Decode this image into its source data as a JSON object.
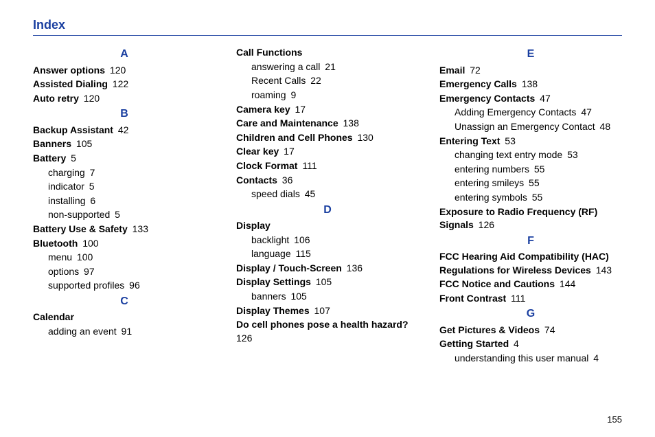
{
  "title": "Index",
  "pageNumber": "155",
  "cols": [
    {
      "blocks": [
        {
          "type": "letter",
          "text": "A"
        },
        {
          "type": "entry",
          "term": "Answer options",
          "page": "120"
        },
        {
          "type": "entry",
          "term": "Assisted Dialing",
          "page": "122"
        },
        {
          "type": "entry",
          "term": "Auto retry",
          "page": "120"
        },
        {
          "type": "letter",
          "text": "B"
        },
        {
          "type": "entry",
          "term": "Backup Assistant",
          "page": "42"
        },
        {
          "type": "entry",
          "term": "Banners",
          "page": "105"
        },
        {
          "type": "entry",
          "term": "Battery",
          "page": "5"
        },
        {
          "type": "sub",
          "term": "charging",
          "page": "7"
        },
        {
          "type": "sub",
          "term": "indicator",
          "page": "5"
        },
        {
          "type": "sub",
          "term": "installing",
          "page": "6"
        },
        {
          "type": "sub",
          "term": "non-supported",
          "page": "5"
        },
        {
          "type": "entry",
          "term": "Battery Use & Safety",
          "page": "133"
        },
        {
          "type": "entry",
          "term": "Bluetooth",
          "page": "100"
        },
        {
          "type": "sub",
          "term": "menu",
          "page": "100"
        },
        {
          "type": "sub",
          "term": "options",
          "page": "97"
        },
        {
          "type": "sub",
          "term": "supported profiles",
          "page": "96"
        },
        {
          "type": "letter",
          "text": "C"
        },
        {
          "type": "entry",
          "term": "Calendar",
          "page": ""
        },
        {
          "type": "sub",
          "term": "adding an event",
          "page": "91"
        }
      ]
    },
    {
      "blocks": [
        {
          "type": "entry",
          "term": "Call Functions",
          "page": ""
        },
        {
          "type": "sub",
          "term": "answering a call",
          "page": "21"
        },
        {
          "type": "sub",
          "term": "Recent Calls",
          "page": "22"
        },
        {
          "type": "sub",
          "term": "roaming",
          "page": "9"
        },
        {
          "type": "entry",
          "term": "Camera key",
          "page": "17"
        },
        {
          "type": "entry",
          "term": "Care and Maintenance",
          "page": "138"
        },
        {
          "type": "entry",
          "term": "Children and Cell Phones",
          "page": "130"
        },
        {
          "type": "entry",
          "term": "Clear key",
          "page": "17"
        },
        {
          "type": "entry",
          "term": "Clock Format",
          "page": "111"
        },
        {
          "type": "entry",
          "term": "Contacts",
          "page": "36"
        },
        {
          "type": "sub",
          "term": "speed dials",
          "page": "45"
        },
        {
          "type": "letter",
          "text": "D"
        },
        {
          "type": "entry",
          "term": "Display",
          "page": ""
        },
        {
          "type": "sub",
          "term": "backlight",
          "page": "106"
        },
        {
          "type": "sub",
          "term": "language",
          "page": "115"
        },
        {
          "type": "entry",
          "term": "Display / Touch-Screen",
          "page": "136"
        },
        {
          "type": "entry",
          "term": "Display Settings",
          "page": "105"
        },
        {
          "type": "sub",
          "term": "banners",
          "page": "105"
        },
        {
          "type": "entry",
          "term": "Display Themes",
          "page": "107"
        },
        {
          "type": "entry-wrap",
          "term": "Do cell phones pose a health hazard?",
          "page": "126"
        }
      ]
    },
    {
      "blocks": [
        {
          "type": "letter",
          "text": "E"
        },
        {
          "type": "entry",
          "term": "Email",
          "page": "72"
        },
        {
          "type": "entry",
          "term": "Emergency Calls",
          "page": "138"
        },
        {
          "type": "entry",
          "term": "Emergency Contacts",
          "page": "47"
        },
        {
          "type": "sub",
          "term": "Adding Emergency Contacts",
          "page": "47"
        },
        {
          "type": "sub",
          "term": "Unassign an Emergency Contact",
          "page": "48"
        },
        {
          "type": "entry",
          "term": "Entering Text",
          "page": "53"
        },
        {
          "type": "sub",
          "term": "changing text entry mode",
          "page": "53"
        },
        {
          "type": "sub",
          "term": "entering numbers",
          "page": "55"
        },
        {
          "type": "sub",
          "term": "entering smileys",
          "page": "55"
        },
        {
          "type": "sub",
          "term": "entering symbols",
          "page": "55"
        },
        {
          "type": "entry-wrap",
          "term": "Exposure to Radio Frequency (RF) Signals",
          "page": "126"
        },
        {
          "type": "letter",
          "text": "F"
        },
        {
          "type": "entry-wrap",
          "term": "FCC Hearing Aid Compatibility (HAC) Regulations for Wireless Devices",
          "page": "143"
        },
        {
          "type": "entry",
          "term": "FCC Notice and Cautions",
          "page": "144"
        },
        {
          "type": "entry",
          "term": "Front Contrast",
          "page": "111"
        },
        {
          "type": "letter",
          "text": "G"
        },
        {
          "type": "entry",
          "term": "Get Pictures & Videos",
          "page": "74"
        },
        {
          "type": "entry",
          "term": "Getting Started",
          "page": "4"
        },
        {
          "type": "sub",
          "term": "understanding this user manual",
          "page": "4"
        }
      ]
    }
  ]
}
